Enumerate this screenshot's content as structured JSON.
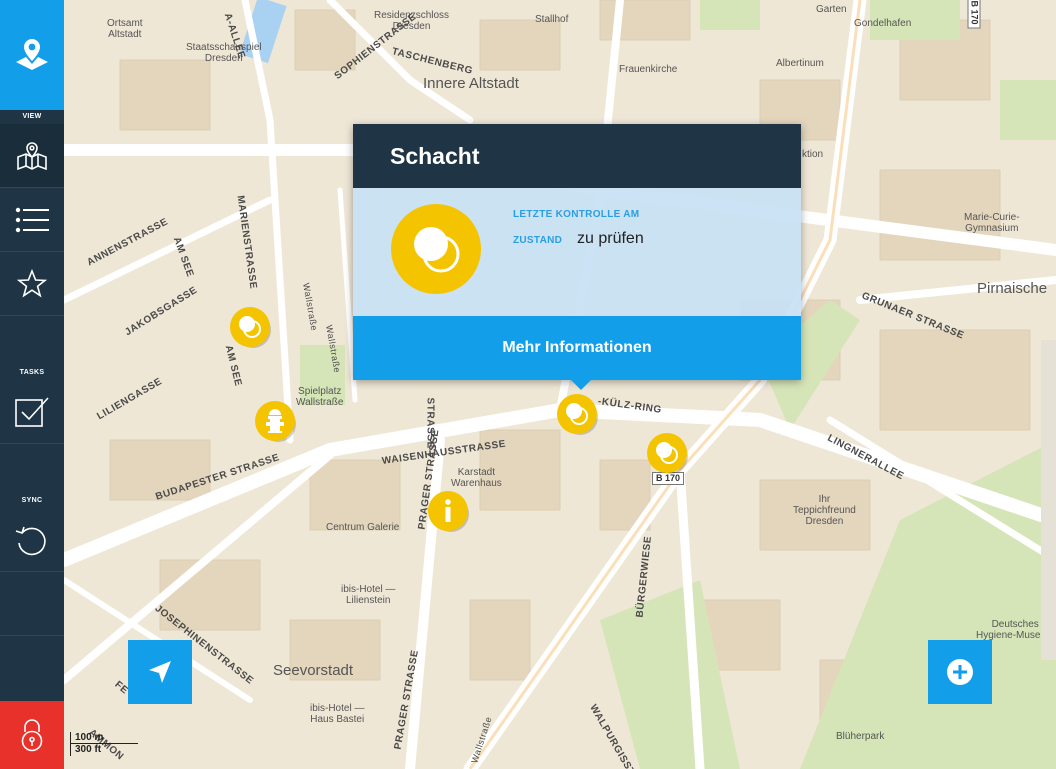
{
  "sidebar": {
    "sections": {
      "view": "VIEW",
      "tasks": "TASKS",
      "sync": "SYNC"
    },
    "logo_icon": "map-pin-logo-icon",
    "items": [
      {
        "id": "map",
        "icon": "map-icon",
        "active": true
      },
      {
        "id": "list",
        "icon": "list-icon",
        "active": false
      },
      {
        "id": "favorites",
        "icon": "star-icon",
        "active": false
      },
      {
        "id": "tasks",
        "icon": "checkbox-icon",
        "active": false
      },
      {
        "id": "sync",
        "icon": "sync-icon",
        "active": false
      }
    ],
    "lock_icon": "lock-icon"
  },
  "map": {
    "places": {
      "ortsamt": "Ortsamt\nAltstadt",
      "residenzschloss": "Residenzschloss\nDresden",
      "stallhof": "Stallhof",
      "garten": "Garten",
      "gondelhafen": "Gondelhafen",
      "staatsschauspiel": "Staatsschauspiel\nDresden",
      "frauenkirche": "Frauenkirche",
      "albertinum": "Albertinum",
      "aktion": "ktion",
      "marie_curie": "Marie-Curie-\nGymnasium",
      "spielplatz": "Spielplatz\nWallstraße",
      "karstadt": "Karstadt\nWarenhaus",
      "teppich": "Ihr\nTeppichfreund\nDresden",
      "centrum": "Centrum Galerie",
      "ibis_lilienstein": "ibis-Hotel —\nLilienstein",
      "ibis_bastei": "ibis-Hotel —\nHaus Bastei",
      "hygiene": "Deutsches\nHygiene-Museum",
      "blueherpark": "Blüherpark"
    },
    "districts": {
      "innere_altstadt": "Innere Altstadt",
      "pirnaische": "Pirnaische",
      "seevorstadt": "Seevorstadt"
    },
    "roads": {
      "allee": "A-ALLEE",
      "sophien": "SOPHIENSTRASSE",
      "taschenberg": "TASCHENBERG",
      "annen": "ANNENSTRASSE",
      "am_see_1": "AM SEE",
      "jakobs": "JAKOBSGASSE",
      "marien": "MARIENSTRASSE",
      "wallstrasse": "Wallstraße",
      "wallstrasse2": "Wallstraße",
      "am_see_2": "AM SEE",
      "lilien": "LILIENGASSE",
      "grunaer": "GRUNAER STRASSE",
      "kuelz": "-KÜLZ-RING",
      "strasse_v": "STRASSE",
      "lingner": "LINGNERALLEE",
      "waisenhaus": "WAISENHAUSSTRASSE",
      "budapester": "BUDAPESTER STRASSE",
      "prager": "PRAGER STRASSE",
      "prager2": "PRAGER STRASSE",
      "buergerwiese": "BÜRGERWIESE",
      "josephinen": "JOSEPHINENSTRASSE",
      "fe": "FE",
      "ammon": "AMMON",
      "walpurgis": "WALPURGISSTR",
      "wallstrasse_low": "Wallstraße"
    },
    "shields": {
      "b170_top": "B 170",
      "b170": "B 170"
    },
    "scale": {
      "metric": "100 m",
      "imperial": "300 ft"
    }
  },
  "markers": [
    {
      "type": "schacht",
      "icon": "manhole-icon"
    },
    {
      "type": "hydrant",
      "icon": "hydrant-icon"
    },
    {
      "type": "schacht",
      "icon": "manhole-icon",
      "selected": true
    },
    {
      "type": "schacht",
      "icon": "manhole-icon"
    },
    {
      "type": "info",
      "icon": "info-icon"
    }
  ],
  "popup": {
    "title": "Schacht",
    "icon": "manhole-icon",
    "last_check_label": "LETZTE KONTROLLE AM",
    "last_check_value": "",
    "state_label": "ZUSTAND",
    "state_value": "zu prüfen",
    "more_button": "Mehr Informationen"
  },
  "buttons": {
    "locate_icon": "navigation-arrow-icon",
    "add_icon": "plus-icon"
  },
  "colors": {
    "primary": "#129ee9",
    "sidebar": "#1f3545",
    "lock": "#e8312b",
    "marker": "#f5c400"
  }
}
